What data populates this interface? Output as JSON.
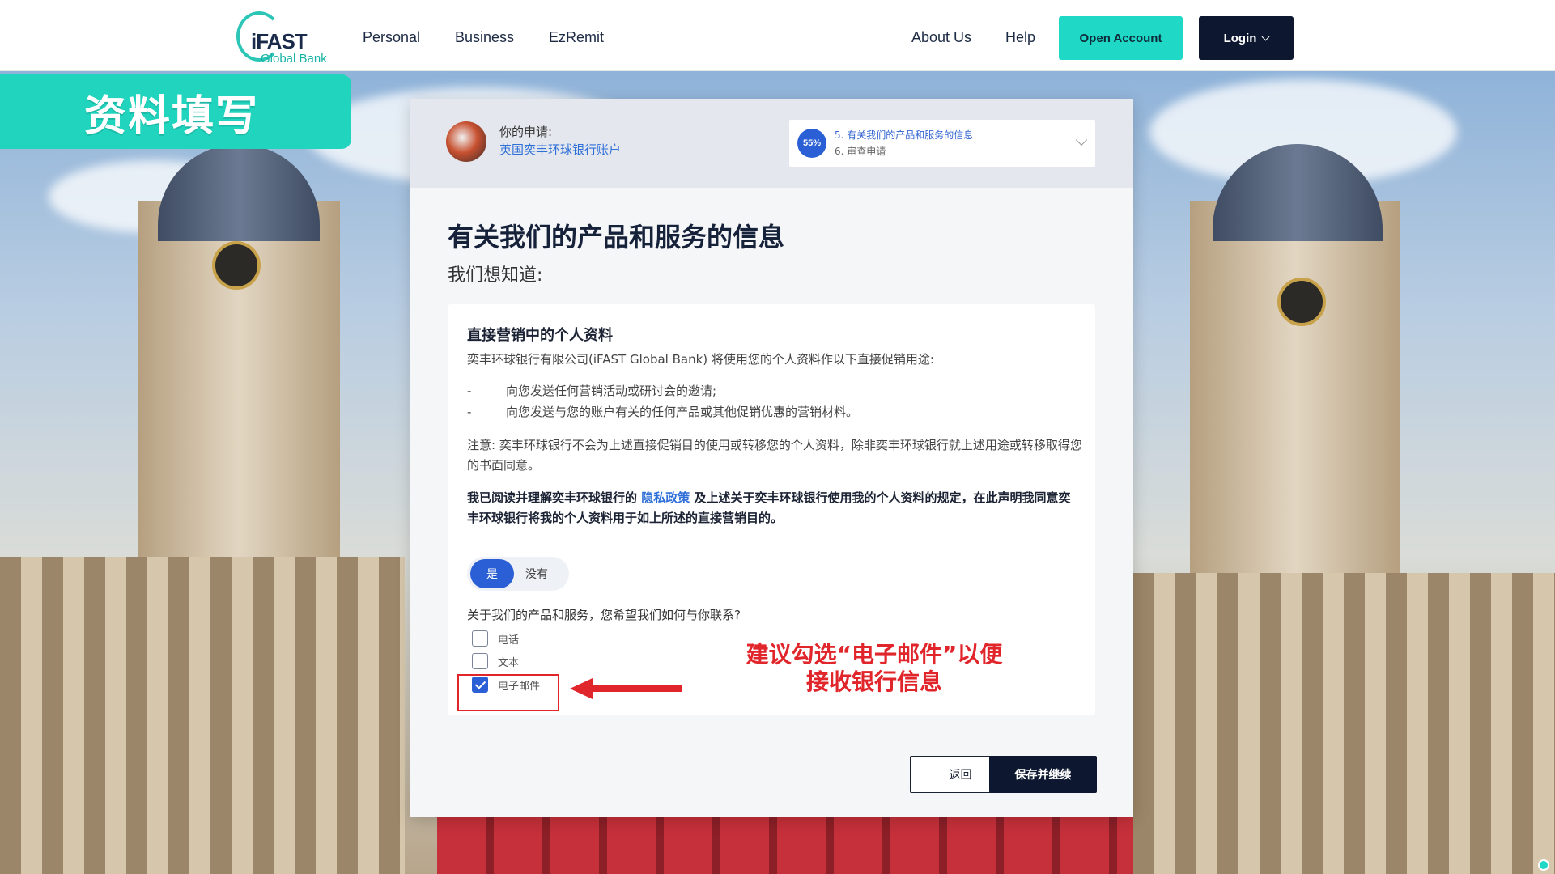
{
  "header": {
    "logo": {
      "word": "iFAST",
      "sub": "Global Bank"
    },
    "nav": [
      "Personal",
      "Business",
      "EzRemit"
    ],
    "right_links": [
      "About Us",
      "Help"
    ],
    "open_account": "Open Account",
    "login": "Login"
  },
  "banner": {
    "text": "资料填写"
  },
  "application": {
    "label": "你的申请:",
    "value": "英国奕丰环球银行账户",
    "progress": "55%",
    "current_step": "5. 有关我们的产品和服务的信息",
    "next_step": "6. 审查申请"
  },
  "page": {
    "title": "有关我们的产品和服务的信息",
    "subtitle": "我们想知道:"
  },
  "section": {
    "heading": "直接营销中的个人资料",
    "intro": "奕丰环球银行有限公司(iFAST Global Bank) 将使用您的个人资料作以下直接促销用途:",
    "bullets": [
      "向您发送任何营销活动或研讨会的邀请;",
      "向您发送与您的账户有关的任何产品或其他促销优惠的营销材料。"
    ],
    "note": "注意: 奕丰环球银行不会为上述直接促销目的使用或转移您的个人资料，除非奕丰环球银行就上述用途或转移取得您的书面同意。",
    "consent_before": "我已阅读并理解奕丰环球银行的",
    "consent_link": "隐私政策",
    "consent_after": "及上述关于奕丰环球银行使用我的个人资料的规定，在此声明我同意奕丰环球银行将我的个人资料用于如上所述的直接营销目的。",
    "toggle_yes": "是",
    "toggle_no": "没有",
    "question": "关于我们的产品和服务，您希望我们如何与你联系?",
    "options": [
      {
        "label": "电话",
        "checked": false
      },
      {
        "label": "文本",
        "checked": false
      },
      {
        "label": "电子邮件",
        "checked": true
      }
    ]
  },
  "actions": {
    "back": "返回",
    "save": "保存并继续"
  },
  "annotation": {
    "line1": "建议勾选“电子邮件”以便",
    "line2": "接收银行信息"
  },
  "colors": {
    "accent": "#1fd8c6",
    "primary": "#2a5fd6",
    "dark": "#0d1830",
    "annotation": "#e0252b"
  }
}
